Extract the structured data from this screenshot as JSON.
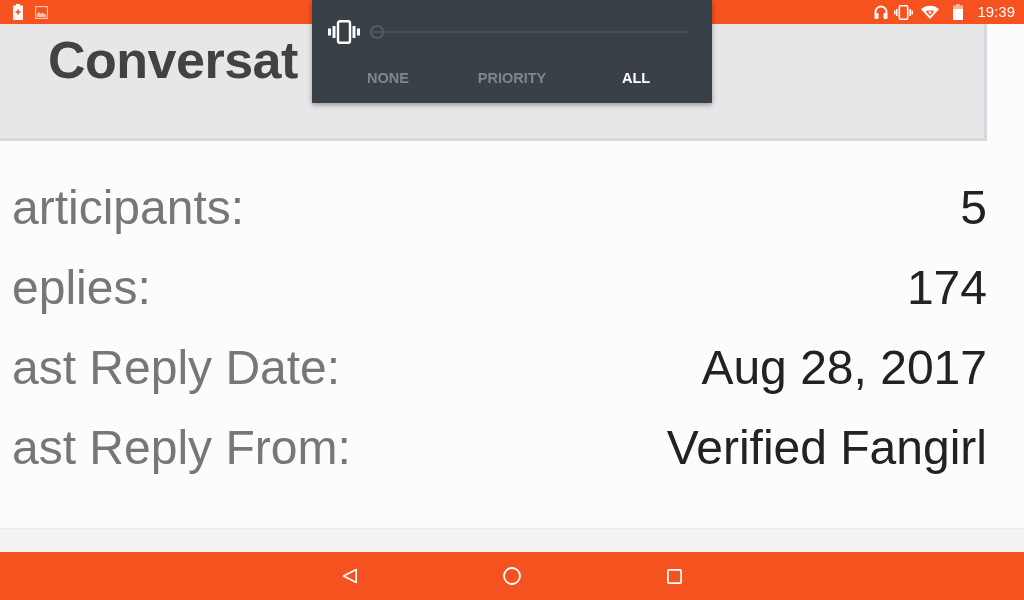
{
  "status_bar": {
    "time": "19:39"
  },
  "volume_panel": {
    "level": 0,
    "modes": [
      {
        "label": "NONE",
        "selected": false
      },
      {
        "label": "PRIORITY",
        "selected": false
      },
      {
        "label": "ALL",
        "selected": true
      }
    ]
  },
  "header": {
    "title": "Conversat"
  },
  "details": [
    {
      "label": "articipants:",
      "value": "5"
    },
    {
      "label": "eplies:",
      "value": "174"
    },
    {
      "label": "ast Reply Date:",
      "value": "Aug 28, 2017"
    },
    {
      "label": "ast Reply From:",
      "value": "Verified Fangirl"
    }
  ]
}
